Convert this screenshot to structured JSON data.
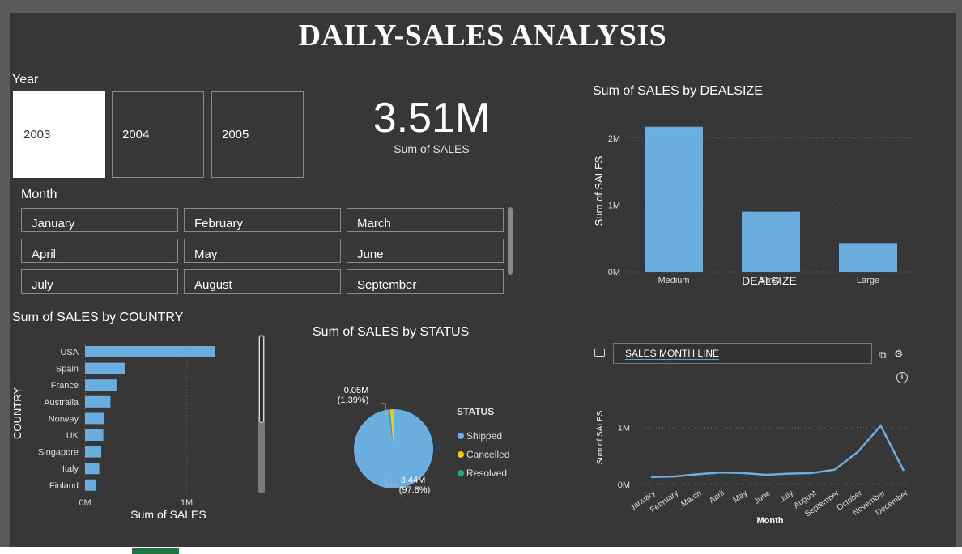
{
  "report": {
    "title": "DAILY-SALES ANALYSIS"
  },
  "year_slicer": {
    "label": "Year",
    "options": [
      "2003",
      "2004",
      "2005"
    ],
    "selected": "2003"
  },
  "kpi": {
    "value": "3.51M",
    "caption": "Sum of SALES"
  },
  "month_slicer": {
    "label": "Month",
    "options": [
      "January",
      "February",
      "March",
      "April",
      "May",
      "June",
      "July",
      "August",
      "September"
    ]
  },
  "ml_box": {
    "text": "SALES MONTH LINE"
  },
  "colors": {
    "accent": "#6aaee0",
    "cancelled": "#f2c811",
    "resolved": "#1aab8a",
    "background": "#373737"
  },
  "chart_data": [
    {
      "type": "bar",
      "title": "Sum of SALES by DEALSIZE",
      "xlabel": "DEALSIZE",
      "ylabel": "Sum of SALES",
      "categories": [
        "Medium",
        "Small",
        "Large"
      ],
      "values": [
        2.17,
        0.9,
        0.42
      ],
      "units": "M",
      "ylim": [
        0,
        2.3
      ],
      "yticks": [
        "0M",
        "1M",
        "2M"
      ],
      "grid": true
    },
    {
      "type": "bar",
      "orientation": "horizontal",
      "title": "Sum of SALES by COUNTRY",
      "xlabel": "Sum of SALES",
      "ylabel": "COUNTRY",
      "categories": [
        "USA",
        "Spain",
        "France",
        "Australia",
        "Norway",
        "UK",
        "Singapore",
        "Italy",
        "Finland"
      ],
      "values": [
        1.28,
        0.39,
        0.31,
        0.25,
        0.19,
        0.18,
        0.16,
        0.14,
        0.11
      ],
      "units": "M",
      "xlim": [
        0,
        1.45
      ],
      "xticks": [
        "0M",
        "1M"
      ]
    },
    {
      "type": "pie",
      "title": "Sum of SALES by STATUS",
      "legend_title": "STATUS",
      "legend_position": "right",
      "slices": [
        {
          "label": "Shipped",
          "value": 3.44,
          "percent": 97.8,
          "label_text": "3.44M",
          "pct_text": "(97.8%)"
        },
        {
          "label": "Cancelled",
          "value": 0.05,
          "percent": 1.39,
          "label_text": "0.05M",
          "pct_text": "(1.39%)"
        },
        {
          "label": "Resolved",
          "value": 0.02,
          "percent": 0.81
        }
      ]
    },
    {
      "type": "line",
      "xlabel": "Month",
      "ylabel": "Sum of SALES",
      "categories": [
        "January",
        "February",
        "March",
        "April",
        "May",
        "June",
        "July",
        "August",
        "September",
        "October",
        "November",
        "December"
      ],
      "values": [
        0.13,
        0.14,
        0.18,
        0.21,
        0.2,
        0.17,
        0.19,
        0.2,
        0.26,
        0.57,
        1.03,
        0.24
      ],
      "units": "M",
      "ylim": [
        0,
        1.25
      ],
      "yticks": [
        "0M",
        "1M"
      ],
      "grid": true
    }
  ]
}
